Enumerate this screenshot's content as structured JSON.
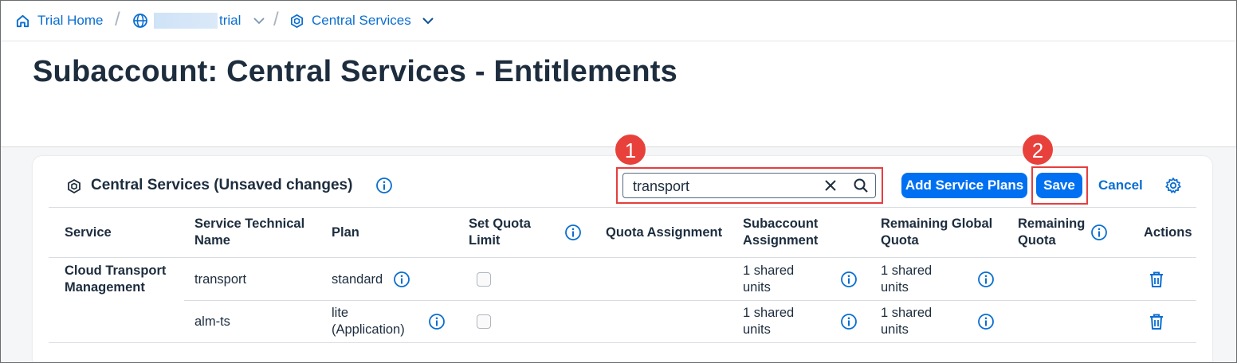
{
  "breadcrumb": {
    "home": "Trial Home",
    "global_account": "trial",
    "subaccount": "Central Services",
    "separator": "/"
  },
  "page_title": "Subaccount: Central Services - Entitlements",
  "card": {
    "title": "Central Services (Unsaved changes)",
    "search_value": "transport",
    "add_button": "Add Service Plans",
    "save_button": "Save",
    "cancel_button": "Cancel"
  },
  "callouts": [
    "1",
    "2"
  ],
  "table": {
    "headers": {
      "service": "Service",
      "tech_name": [
        "Service Technical",
        "Name"
      ],
      "plan": "Plan",
      "quota_limit": [
        "Set Quota",
        "Limit"
      ],
      "quota_assignment": "Quota Assignment",
      "subaccount_assignment": [
        "Subaccount",
        "Assignment"
      ],
      "remaining_global": [
        "Remaining Global",
        "Quota"
      ],
      "remaining_quota": [
        "Remaining",
        "Quota"
      ],
      "actions": "Actions"
    },
    "service_name": [
      "Cloud Transport",
      "Management"
    ],
    "rows": [
      {
        "tech_name": "transport",
        "plan": [
          "standard"
        ],
        "sub_assign": [
          "1 shared",
          "units"
        ],
        "remaining_global": [
          "1 shared",
          "units"
        ]
      },
      {
        "tech_name": "alm-ts",
        "plan": [
          "lite",
          "(Application)"
        ],
        "sub_assign": [
          "1 shared",
          "units"
        ],
        "remaining_global": [
          "1 shared",
          "units"
        ]
      }
    ]
  },
  "colors": {
    "accent": "#0070f2",
    "link": "#0a6ed1",
    "highlight": "#e63e3e",
    "text": "#1d2d3e"
  }
}
